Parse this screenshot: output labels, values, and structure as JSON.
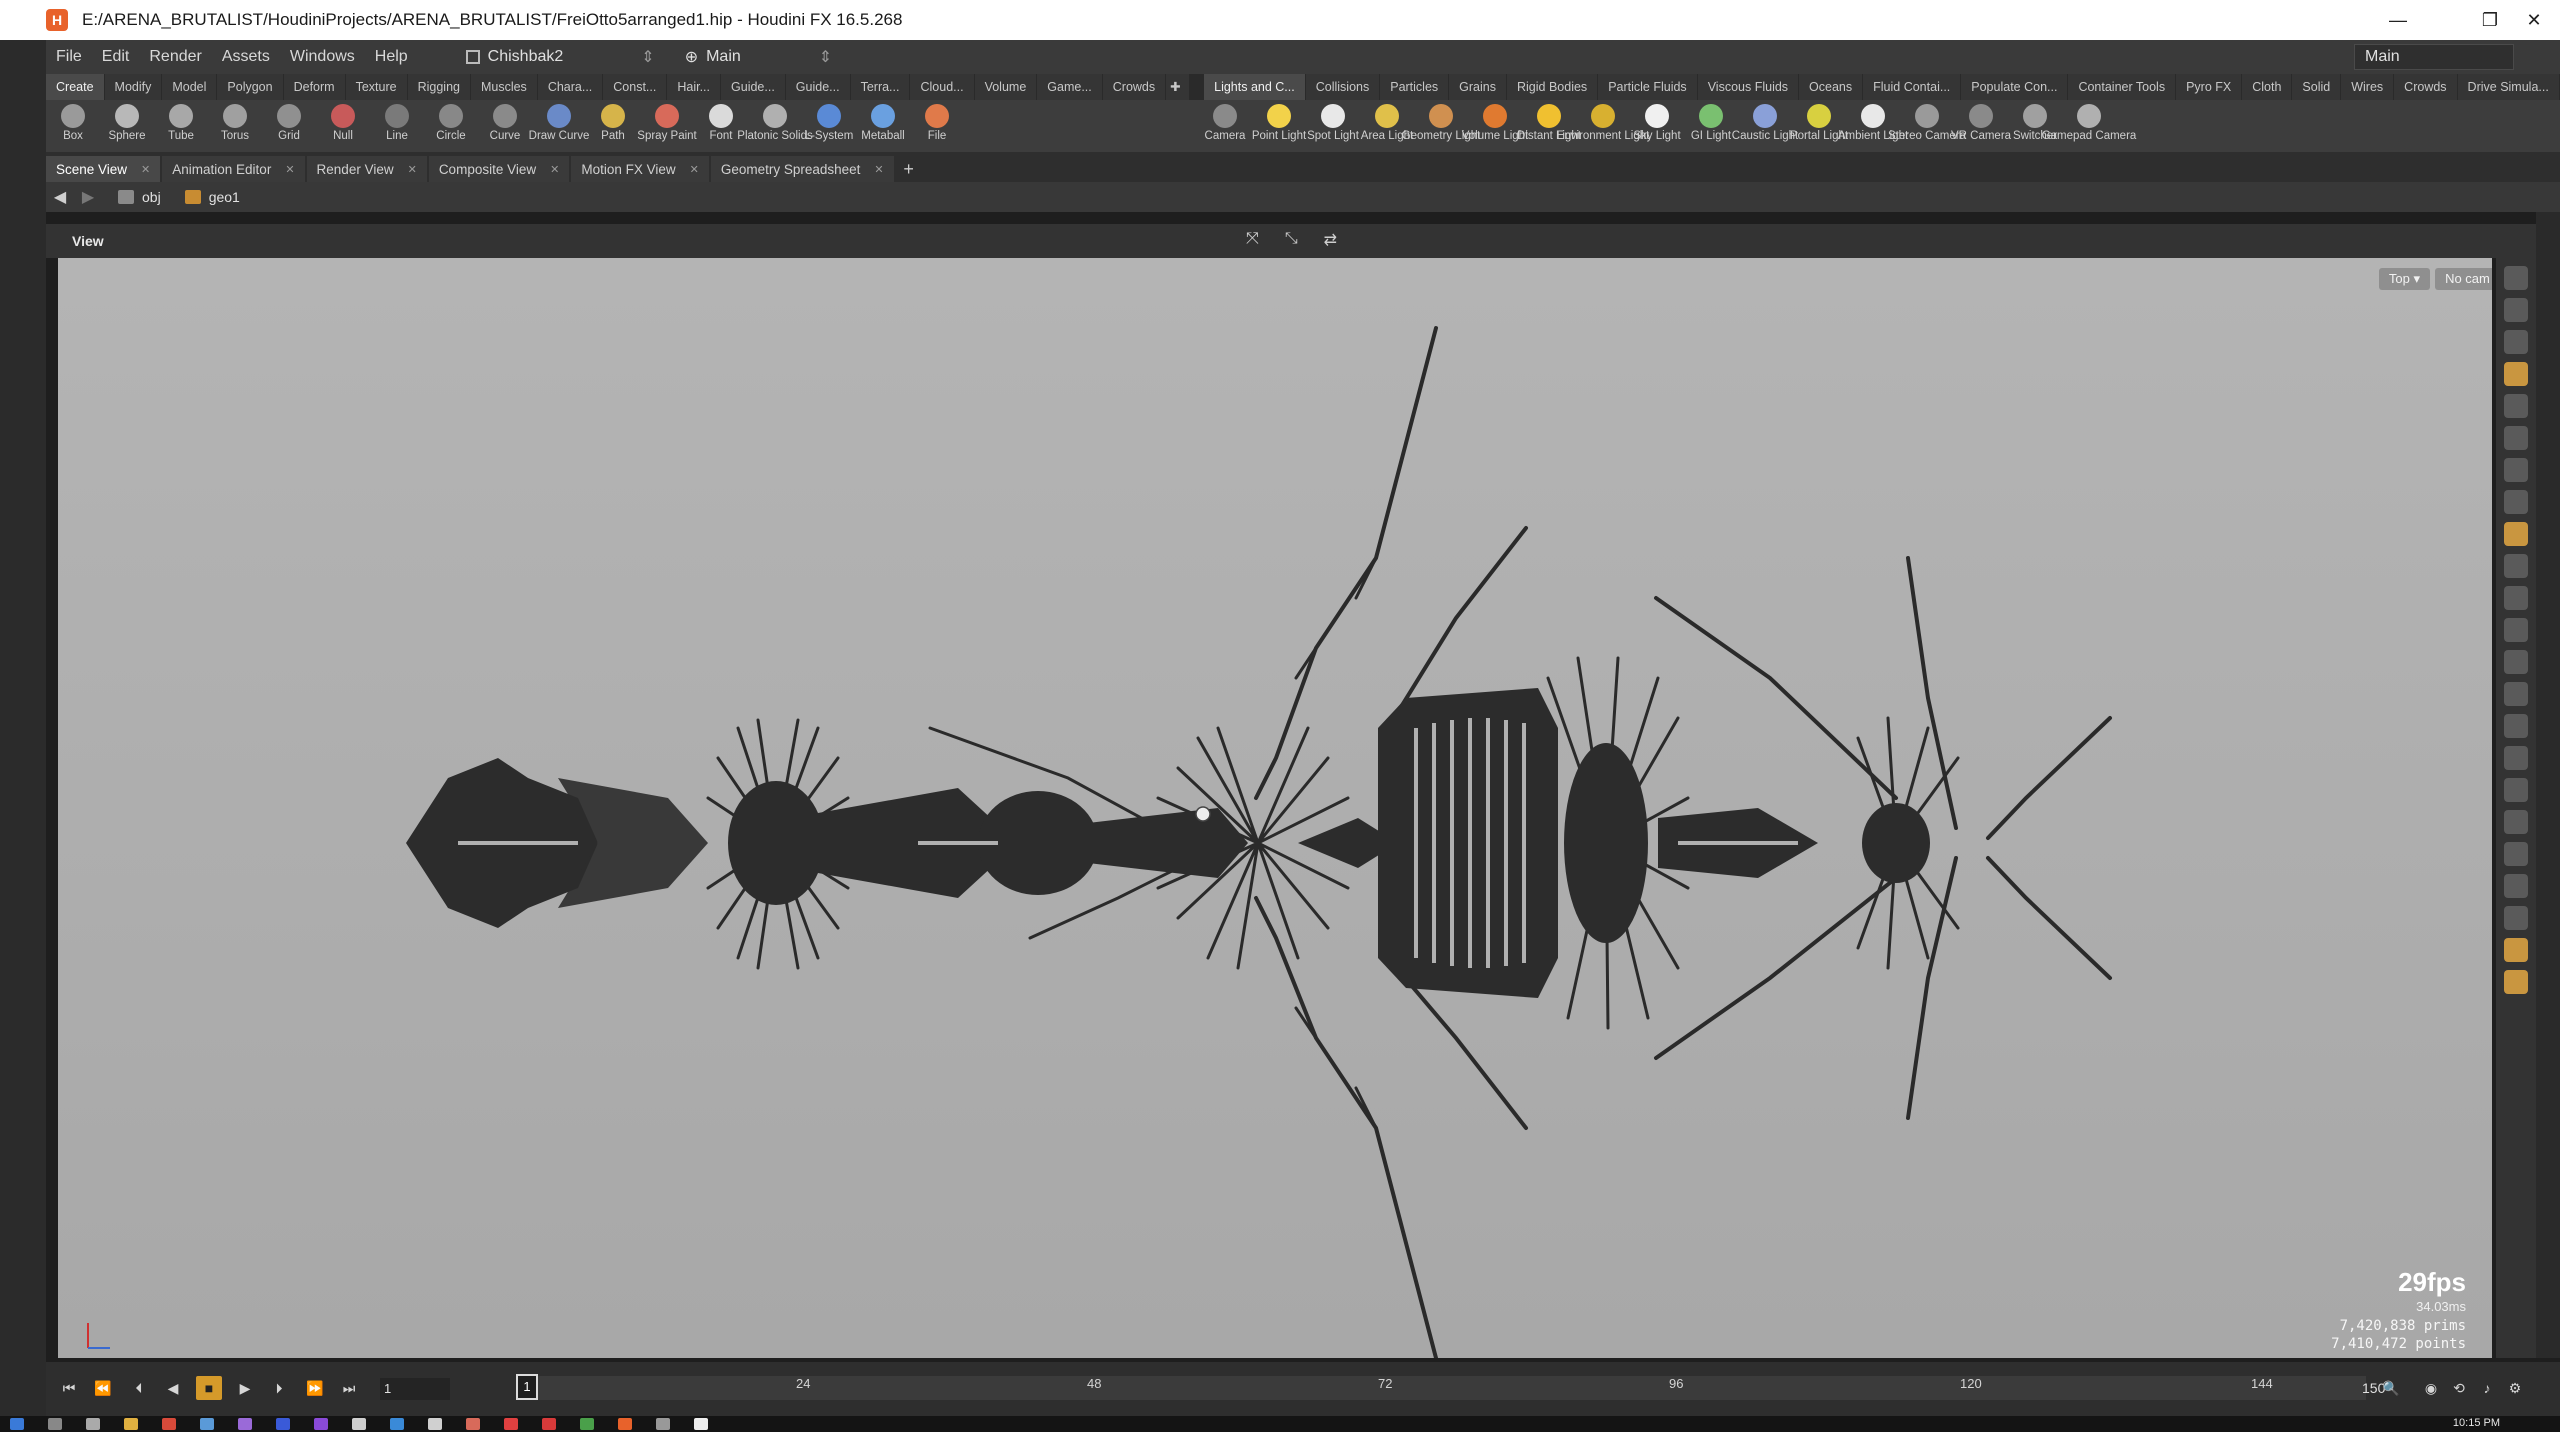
{
  "window": {
    "title": "E:/ARENA_BRUTALIST/HoudiniProjects/ARENA_BRUTALIST/FreiOtto5arranged1.hip - Houdini FX 16.5.268",
    "minimize": "—",
    "maximize": "❐",
    "close": "✕"
  },
  "menu": {
    "items": [
      "File",
      "Edit",
      "Render",
      "Assets",
      "Windows",
      "Help"
    ],
    "desktop": "Chishbak2",
    "runtime": "Main",
    "right_desktop": "Main"
  },
  "shelf_tabs_left": [
    "Create",
    "Modify",
    "Model",
    "Polygon",
    "Deform",
    "Texture",
    "Rigging",
    "Muscles",
    "Chara...",
    "Const...",
    "Hair...",
    "Guide...",
    "Guide...",
    "Terra...",
    "Cloud...",
    "Volume",
    "Game...",
    "Crowds"
  ],
  "shelf_tabs_right": [
    "Lights and C...",
    "Collisions",
    "Particles",
    "Grains",
    "Rigid Bodies",
    "Particle Fluids",
    "Viscous Fluids",
    "Oceans",
    "Fluid Contai...",
    "Populate Con...",
    "Container Tools",
    "Pyro FX",
    "Cloth",
    "Solid",
    "Wires",
    "Crowds",
    "Drive Simula..."
  ],
  "tools_left": [
    {
      "label": "Box",
      "color": "#9a9a9a"
    },
    {
      "label": "Sphere",
      "color": "#b8b8b8"
    },
    {
      "label": "Tube",
      "color": "#a8a8a8"
    },
    {
      "label": "Torus",
      "color": "#a0a0a0"
    },
    {
      "label": "Grid",
      "color": "#909090"
    },
    {
      "label": "Null",
      "color": "#c85a5a"
    },
    {
      "label": "Line",
      "color": "#7a7a7a"
    },
    {
      "label": "Circle",
      "color": "#888888"
    },
    {
      "label": "Curve",
      "color": "#8a8a8a"
    },
    {
      "label": "Draw Curve",
      "color": "#6a8ac8"
    },
    {
      "label": "Path",
      "color": "#d6b44a"
    },
    {
      "label": "Spray Paint",
      "color": "#d86a5a"
    },
    {
      "label": "Font",
      "color": "#dadada"
    },
    {
      "label": "Platonic Solids",
      "color": "#b0b0b0"
    },
    {
      "label": "L-System",
      "color": "#5a8ad6"
    },
    {
      "label": "Metaball",
      "color": "#6aa0e0"
    },
    {
      "label": "File",
      "color": "#e07a4a"
    }
  ],
  "tools_right": [
    {
      "label": "Camera",
      "color": "#8a8a8a"
    },
    {
      "label": "Point Light",
      "color": "#f2d24a"
    },
    {
      "label": "Spot Light",
      "color": "#e8e8e8"
    },
    {
      "label": "Area Light",
      "color": "#e0c04a"
    },
    {
      "label": "Geometry Light",
      "color": "#d09050"
    },
    {
      "label": "Volume Light",
      "color": "#e07a30"
    },
    {
      "label": "Distant Light",
      "color": "#f0c030"
    },
    {
      "label": "Environment Light",
      "color": "#d8b030"
    },
    {
      "label": "Sky Light",
      "color": "#f0f0f0"
    },
    {
      "label": "GI Light",
      "color": "#7ac070"
    },
    {
      "label": "Caustic Light",
      "color": "#8aa0d8"
    },
    {
      "label": "Portal Light",
      "color": "#d8d040"
    },
    {
      "label": "Ambient Light",
      "color": "#e8e8e8"
    },
    {
      "label": "Stereo Camera",
      "color": "#9a9a9a"
    },
    {
      "label": "VR Camera",
      "color": "#8a8a8a"
    },
    {
      "label": "Switcher",
      "color": "#a0a0a0"
    },
    {
      "label": "Gamepad Camera",
      "color": "#b0b0b0"
    }
  ],
  "pane_tabs": [
    "Scene View",
    "Animation Editor",
    "Render View",
    "Composite View",
    "Motion FX View",
    "Geometry Spreadsheet"
  ],
  "path": {
    "root": "obj",
    "node": "geo1"
  },
  "viewer": {
    "title": "View",
    "view_menu": "Top ▾",
    "cam_menu": "No cam ▾",
    "fps": "29fps",
    "ms": "34.03ms",
    "prims": "7,420,838  prims",
    "points": "7,410,472  points"
  },
  "timeline": {
    "current_frame": "1",
    "start_field": "1",
    "end": "150",
    "ticks": [
      "24",
      "48",
      "72",
      "96",
      "120",
      "144"
    ]
  },
  "taskbar": {
    "clock": "10:15 PM"
  }
}
